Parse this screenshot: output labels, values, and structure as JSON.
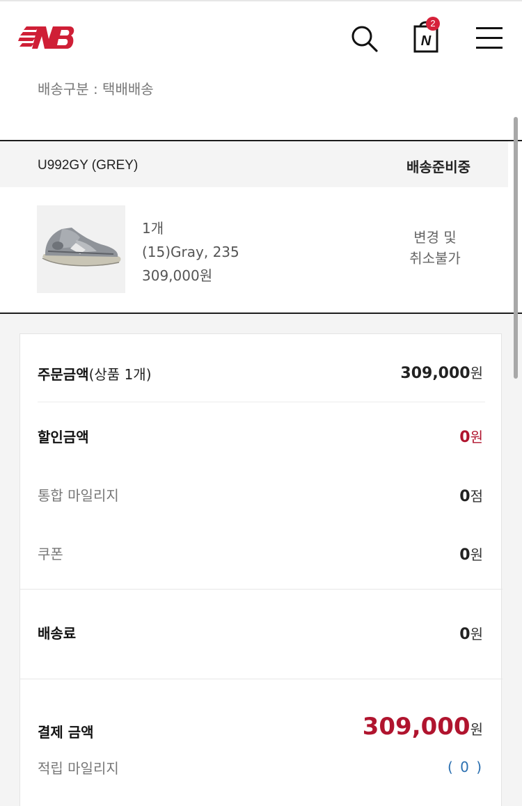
{
  "header": {
    "cart_count": "2",
    "cart_letter": "N"
  },
  "shipping": {
    "type_text": "배송구분 : 택배배송"
  },
  "order_item": {
    "model": "U992GY (GREY)",
    "status": "배송준비중",
    "quantity": "1개",
    "option": "(15)Gray, 235",
    "price": "309,000원",
    "note_line1": "변경 및",
    "note_line2": "취소불가"
  },
  "summary": {
    "order_amount_label": "주문금액",
    "order_amount_sub": "(상품 1개)",
    "order_amount_num": "309,000",
    "order_amount_unit": "원",
    "discount_label": "할인금액",
    "discount_num": "0",
    "discount_unit": "원",
    "mileage_label": "통합 마일리지",
    "mileage_num": "0",
    "mileage_unit": "점",
    "coupon_label": "쿠폰",
    "coupon_num": "0",
    "coupon_unit": "원",
    "shipping_fee_label": "배송료",
    "shipping_fee_num": "0",
    "shipping_fee_unit": "원",
    "payment_label": "결제 금액",
    "payment_num": "309,000",
    "payment_unit": "원",
    "earn_label": "적립 마일리지",
    "earn_value": "( 0 )"
  },
  "colors": {
    "brand_red": "#cf1f36",
    "price_red": "#b0142e",
    "link_blue": "#2a6fb0"
  },
  "icons": [
    "new-balance-logo",
    "search-icon",
    "shopping-bag-icon",
    "hamburger-menu-icon"
  ]
}
